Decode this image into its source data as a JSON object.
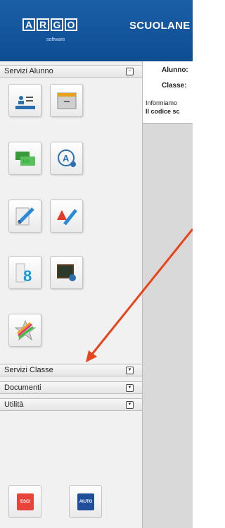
{
  "header": {
    "logo_letters": [
      "A",
      "R",
      "G",
      "O"
    ],
    "logo_sub": "software",
    "brand": "SCUOLANE"
  },
  "sidebar": {
    "servizi_alunno": "Servizi Alunno",
    "servizi_classe": "Servizi Classe",
    "documenti": "Documenti",
    "utilita": "Utilità",
    "toggle_open": "−",
    "toggle_closed": "▾"
  },
  "tiles": [
    {
      "name": "anagrafe-icon"
    },
    {
      "name": "archive-icon"
    },
    {
      "name": "tasse-icon"
    },
    {
      "name": "assenze-icon"
    },
    {
      "name": "voti-icon"
    },
    {
      "name": "note-icon"
    },
    {
      "name": "orario-icon"
    },
    {
      "name": "ricevimento-icon"
    },
    {
      "name": "curriculum-icon"
    }
  ],
  "buttons": {
    "esci": "ESCI",
    "aiuto": "AIUTO"
  },
  "main": {
    "alunno_label": "Alunno:",
    "classe_label": "Classe:",
    "info_text": "Informiamo",
    "codice_text": "Il codice sc"
  },
  "colors": {
    "header": "#1a5fa8",
    "arrow": "#e8441c",
    "esci": "#e8443a",
    "aiuto": "#1f4f9a"
  }
}
